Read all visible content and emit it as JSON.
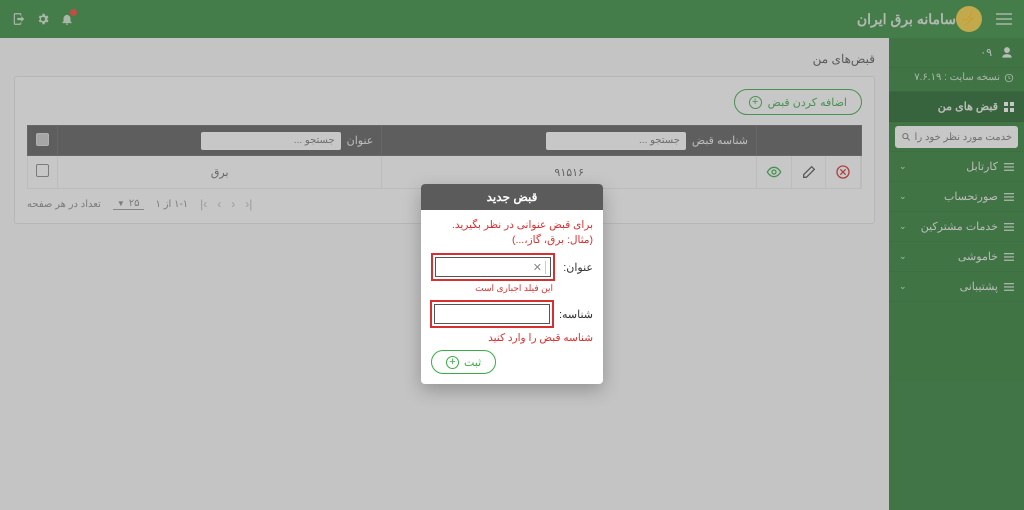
{
  "brand": {
    "title": "سامانه برق ایران"
  },
  "header": {
    "user_code": "۰۹"
  },
  "sidebar": {
    "version_label": "نسخه سایت : ۷.۶.۱۹",
    "search_placeholder": "خدمت مورد نظر خود را جستجو کنید",
    "items": [
      {
        "label": "قبض های من",
        "active": true
      },
      {
        "label": "کارتابل"
      },
      {
        "label": "صورتحساب"
      },
      {
        "label": "خدمات مشترکین"
      },
      {
        "label": "خاموشی"
      },
      {
        "label": "پشتیبانی"
      }
    ]
  },
  "page": {
    "title": "قبض‌های من",
    "add_button": "اضافه کردن قبض",
    "columns": {
      "title_label": "عنوان",
      "id_label": "شناسه قبض",
      "search_placeholder": "جستجو ..."
    },
    "rows": [
      {
        "title": "برق",
        "bill_id": "۹۱۵۱۶"
      }
    ],
    "pager": {
      "per_page_label": "تعداد در هر صفحه",
      "per_page_value": "۲۵",
      "range": "۱-۱ از ۱"
    }
  },
  "modal": {
    "title": "قبض جدید",
    "hint_top": "برای قبض عنوانی در نظر بگیرید. (مثال: برق، گاز،...)",
    "field_title_label": "عنوان:",
    "field_title_error": "این فیلد اجباری است",
    "field_id_label": "شناسه:",
    "hint_bottom": "شناسه قبض را وارد کنید",
    "submit": "ثبت"
  }
}
